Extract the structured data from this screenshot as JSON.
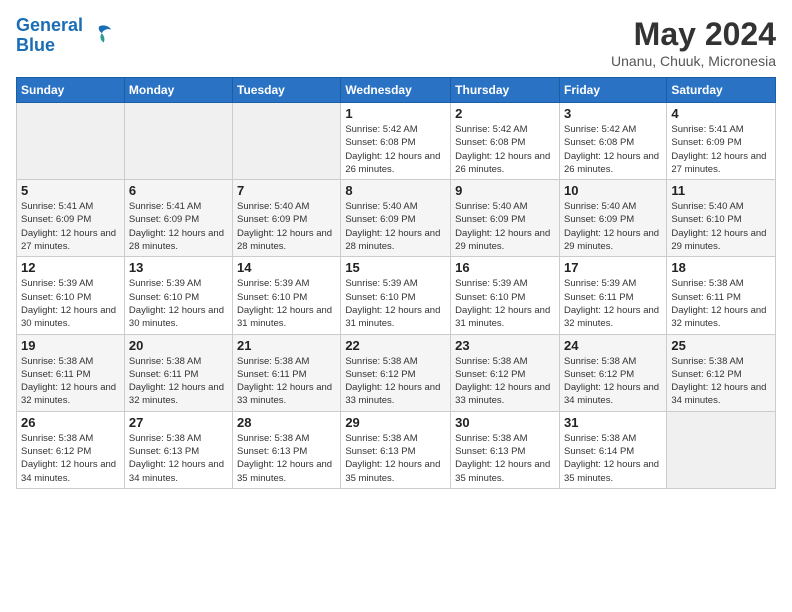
{
  "header": {
    "logo_general": "General",
    "logo_blue": "Blue",
    "month_title": "May 2024",
    "location": "Unanu, Chuuk, Micronesia"
  },
  "days_of_week": [
    "Sunday",
    "Monday",
    "Tuesday",
    "Wednesday",
    "Thursday",
    "Friday",
    "Saturday"
  ],
  "weeks": [
    [
      {
        "day": "",
        "info": ""
      },
      {
        "day": "",
        "info": ""
      },
      {
        "day": "",
        "info": ""
      },
      {
        "day": "1",
        "info": "Sunrise: 5:42 AM\nSunset: 6:08 PM\nDaylight: 12 hours and 26 minutes."
      },
      {
        "day": "2",
        "info": "Sunrise: 5:42 AM\nSunset: 6:08 PM\nDaylight: 12 hours and 26 minutes."
      },
      {
        "day": "3",
        "info": "Sunrise: 5:42 AM\nSunset: 6:08 PM\nDaylight: 12 hours and 26 minutes."
      },
      {
        "day": "4",
        "info": "Sunrise: 5:41 AM\nSunset: 6:09 PM\nDaylight: 12 hours and 27 minutes."
      }
    ],
    [
      {
        "day": "5",
        "info": "Sunrise: 5:41 AM\nSunset: 6:09 PM\nDaylight: 12 hours and 27 minutes."
      },
      {
        "day": "6",
        "info": "Sunrise: 5:41 AM\nSunset: 6:09 PM\nDaylight: 12 hours and 28 minutes."
      },
      {
        "day": "7",
        "info": "Sunrise: 5:40 AM\nSunset: 6:09 PM\nDaylight: 12 hours and 28 minutes."
      },
      {
        "day": "8",
        "info": "Sunrise: 5:40 AM\nSunset: 6:09 PM\nDaylight: 12 hours and 28 minutes."
      },
      {
        "day": "9",
        "info": "Sunrise: 5:40 AM\nSunset: 6:09 PM\nDaylight: 12 hours and 29 minutes."
      },
      {
        "day": "10",
        "info": "Sunrise: 5:40 AM\nSunset: 6:09 PM\nDaylight: 12 hours and 29 minutes."
      },
      {
        "day": "11",
        "info": "Sunrise: 5:40 AM\nSunset: 6:10 PM\nDaylight: 12 hours and 29 minutes."
      }
    ],
    [
      {
        "day": "12",
        "info": "Sunrise: 5:39 AM\nSunset: 6:10 PM\nDaylight: 12 hours and 30 minutes."
      },
      {
        "day": "13",
        "info": "Sunrise: 5:39 AM\nSunset: 6:10 PM\nDaylight: 12 hours and 30 minutes."
      },
      {
        "day": "14",
        "info": "Sunrise: 5:39 AM\nSunset: 6:10 PM\nDaylight: 12 hours and 31 minutes."
      },
      {
        "day": "15",
        "info": "Sunrise: 5:39 AM\nSunset: 6:10 PM\nDaylight: 12 hours and 31 minutes."
      },
      {
        "day": "16",
        "info": "Sunrise: 5:39 AM\nSunset: 6:10 PM\nDaylight: 12 hours and 31 minutes."
      },
      {
        "day": "17",
        "info": "Sunrise: 5:39 AM\nSunset: 6:11 PM\nDaylight: 12 hours and 32 minutes."
      },
      {
        "day": "18",
        "info": "Sunrise: 5:38 AM\nSunset: 6:11 PM\nDaylight: 12 hours and 32 minutes."
      }
    ],
    [
      {
        "day": "19",
        "info": "Sunrise: 5:38 AM\nSunset: 6:11 PM\nDaylight: 12 hours and 32 minutes."
      },
      {
        "day": "20",
        "info": "Sunrise: 5:38 AM\nSunset: 6:11 PM\nDaylight: 12 hours and 32 minutes."
      },
      {
        "day": "21",
        "info": "Sunrise: 5:38 AM\nSunset: 6:11 PM\nDaylight: 12 hours and 33 minutes."
      },
      {
        "day": "22",
        "info": "Sunrise: 5:38 AM\nSunset: 6:12 PM\nDaylight: 12 hours and 33 minutes."
      },
      {
        "day": "23",
        "info": "Sunrise: 5:38 AM\nSunset: 6:12 PM\nDaylight: 12 hours and 33 minutes."
      },
      {
        "day": "24",
        "info": "Sunrise: 5:38 AM\nSunset: 6:12 PM\nDaylight: 12 hours and 34 minutes."
      },
      {
        "day": "25",
        "info": "Sunrise: 5:38 AM\nSunset: 6:12 PM\nDaylight: 12 hours and 34 minutes."
      }
    ],
    [
      {
        "day": "26",
        "info": "Sunrise: 5:38 AM\nSunset: 6:12 PM\nDaylight: 12 hours and 34 minutes."
      },
      {
        "day": "27",
        "info": "Sunrise: 5:38 AM\nSunset: 6:13 PM\nDaylight: 12 hours and 34 minutes."
      },
      {
        "day": "28",
        "info": "Sunrise: 5:38 AM\nSunset: 6:13 PM\nDaylight: 12 hours and 35 minutes."
      },
      {
        "day": "29",
        "info": "Sunrise: 5:38 AM\nSunset: 6:13 PM\nDaylight: 12 hours and 35 minutes."
      },
      {
        "day": "30",
        "info": "Sunrise: 5:38 AM\nSunset: 6:13 PM\nDaylight: 12 hours and 35 minutes."
      },
      {
        "day": "31",
        "info": "Sunrise: 5:38 AM\nSunset: 6:14 PM\nDaylight: 12 hours and 35 minutes."
      },
      {
        "day": "",
        "info": ""
      }
    ]
  ]
}
